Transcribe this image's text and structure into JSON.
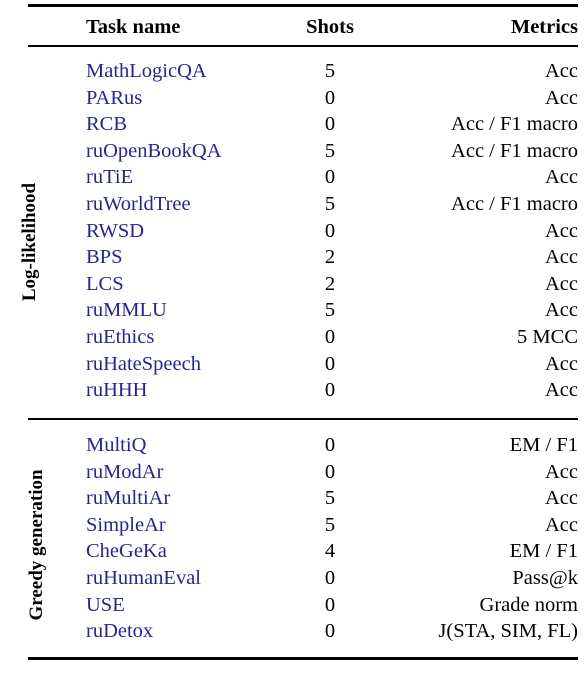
{
  "table": {
    "columns": {
      "group": "",
      "task_name": "Task name",
      "shots": "Shots",
      "metrics": "Metrics"
    },
    "accent_color": "#26268c",
    "text_color": "#000000",
    "groups": [
      {
        "label": "Log-likelihood",
        "rows": [
          {
            "task": "MathLogicQA",
            "shots": "5",
            "metrics": "Acc"
          },
          {
            "task": "PARus",
            "shots": "0",
            "metrics": "Acc"
          },
          {
            "task": "RCB",
            "shots": "0",
            "metrics": "Acc / F1 macro"
          },
          {
            "task": "ruOpenBookQA",
            "shots": "5",
            "metrics": "Acc / F1 macro"
          },
          {
            "task": "ruTiE",
            "shots": "0",
            "metrics": "Acc"
          },
          {
            "task": "ruWorldTree",
            "shots": "5",
            "metrics": "Acc / F1 macro"
          },
          {
            "task": "RWSD",
            "shots": "0",
            "metrics": "Acc"
          },
          {
            "task": "BPS",
            "shots": "2",
            "metrics": "Acc"
          },
          {
            "task": "LCS",
            "shots": "2",
            "metrics": "Acc"
          },
          {
            "task": "ruMMLU",
            "shots": "5",
            "metrics": "Acc"
          },
          {
            "task": "ruEthics",
            "shots": "0",
            "metrics": "5 MCC"
          },
          {
            "task": "ruHateSpeech",
            "shots": "0",
            "metrics": "Acc"
          },
          {
            "task": "ruHHH",
            "shots": "0",
            "metrics": "Acc"
          }
        ]
      },
      {
        "label": "Greedy generation",
        "rows": [
          {
            "task": "MultiQ",
            "shots": "0",
            "metrics": "EM / F1"
          },
          {
            "task": "ruModAr",
            "shots": "0",
            "metrics": "Acc"
          },
          {
            "task": "ruMultiAr",
            "shots": "5",
            "metrics": "Acc"
          },
          {
            "task": "SimpleAr",
            "shots": "5",
            "metrics": "Acc"
          },
          {
            "task": "CheGeKa",
            "shots": "4",
            "metrics": "EM / F1"
          },
          {
            "task": "ruHumanEval",
            "shots": "0",
            "metrics": "Pass@k"
          },
          {
            "task": "USE",
            "shots": "0",
            "metrics": "Grade norm"
          },
          {
            "task": "ruDetox",
            "shots": "0",
            "metrics": "J(STA, SIM, FL)"
          }
        ]
      }
    ]
  }
}
